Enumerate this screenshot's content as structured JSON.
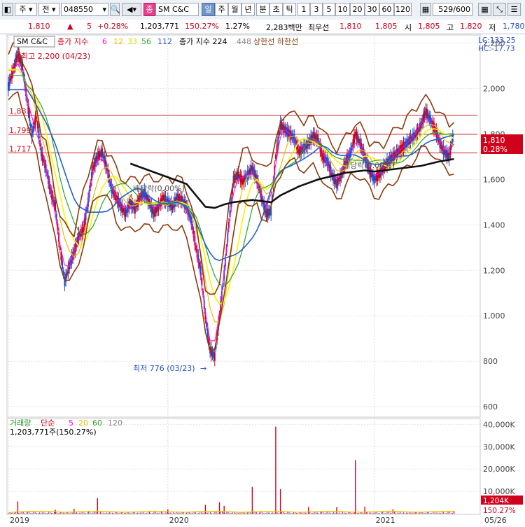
{
  "toolbar": {
    "kind": "주",
    "jeon": "전",
    "code": "048550",
    "jong": "종",
    "name": "SM C&C",
    "periods": [
      "일",
      "주",
      "월",
      "년",
      "분",
      "초",
      "틱"
    ],
    "active_period": "일",
    "intervals": [
      "1",
      "3",
      "5",
      "10",
      "20",
      "30",
      "60",
      "120"
    ],
    "count": "529",
    "total": "/600"
  },
  "info": {
    "price": "1,810",
    "change": "5",
    "change_pct": "+0.28%",
    "volume": "1,203,771",
    "vol_ratio": "150.27%",
    "turnover_rate": "1.27%",
    "amount": "2,283백만",
    "best_label": "최우선",
    "best_ask": "1,810",
    "best_bid": "1,805",
    "open_label": "시",
    "open": "1,805",
    "high_label": "고",
    "high": "1,820",
    "low_label": "저",
    "low": "1,780"
  },
  "legend": {
    "name": "SM C&C",
    "ma_label": "종가 지수",
    "ma_periods": [
      "6",
      "12",
      "33",
      "56",
      "112"
    ],
    "ma_colors": [
      "#ff00ff",
      "#e8c000",
      "#f0f000",
      "#2ca02c",
      "#1f5fd0"
    ],
    "ma2_label": "종가 지수 224",
    "ma2_period": "448",
    "limit_labels": "상한선 하한선",
    "lc": "LC:133.25",
    "hc": "HC:-17.73",
    "max_note": "최고 2,200 (04/23)",
    "min_note": "최저 776 (03/23)",
    "dividend_note1": "배당락(0.00%)",
    "dividend_note2": "배당락(0.00%)",
    "current_price_tag": "1,810",
    "current_pct_tag": "0.28%"
  },
  "volume_legend": {
    "label": "거래량",
    "ma_label": "단순",
    "periods": [
      "5",
      "20",
      "60",
      "120"
    ],
    "value": "1,203,771주(150.27%)",
    "current_tag": "1,204K",
    "current_pct": "150.27%"
  },
  "chart_data": {
    "type": "line",
    "price_axis": {
      "ylim": [
        560,
        2230
      ],
      "ticks": [
        "2,200",
        "2,000",
        "1,800",
        "1,600",
        "1,400",
        "1,200",
        "1,000",
        "800",
        "600"
      ],
      "tick_values": [
        2200,
        2000,
        1800,
        1600,
        1400,
        1200,
        1000,
        800,
        600
      ]
    },
    "h_lines": [
      {
        "label": "1,883",
        "value": 1883
      },
      {
        "label": "1,799",
        "value": 1799
      },
      {
        "label": "1,717",
        "value": 1717
      }
    ],
    "x_ticks": [
      "2019",
      "2020",
      "2021",
      "05/26"
    ],
    "x_tick_pos": [
      0,
      0.34,
      0.78,
      1.0
    ],
    "close_series": [
      [
        0,
        2010
      ],
      [
        0.01,
        2080
      ],
      [
        0.02,
        2150
      ],
      [
        0.03,
        2100
      ],
      [
        0.04,
        1950
      ],
      [
        0.05,
        1800
      ],
      [
        0.06,
        1880
      ],
      [
        0.07,
        1720
      ],
      [
        0.08,
        1650
      ],
      [
        0.09,
        1550
      ],
      [
        0.1,
        1480
      ],
      [
        0.11,
        1300
      ],
      [
        0.12,
        1150
      ],
      [
        0.13,
        1220
      ],
      [
        0.14,
        1280
      ],
      [
        0.15,
        1350
      ],
      [
        0.16,
        1380
      ],
      [
        0.17,
        1500
      ],
      [
        0.18,
        1650
      ],
      [
        0.19,
        1700
      ],
      [
        0.2,
        1720
      ],
      [
        0.21,
        1650
      ],
      [
        0.22,
        1560
      ],
      [
        0.23,
        1520
      ],
      [
        0.24,
        1480
      ],
      [
        0.25,
        1450
      ],
      [
        0.26,
        1500
      ],
      [
        0.27,
        1470
      ],
      [
        0.28,
        1520
      ],
      [
        0.29,
        1540
      ],
      [
        0.3,
        1500
      ],
      [
        0.31,
        1450
      ],
      [
        0.32,
        1480
      ],
      [
        0.33,
        1520
      ],
      [
        0.34,
        1500
      ],
      [
        0.35,
        1480
      ],
      [
        0.36,
        1520
      ],
      [
        0.37,
        1510
      ],
      [
        0.38,
        1480
      ],
      [
        0.39,
        1420
      ],
      [
        0.4,
        1300
      ],
      [
        0.41,
        1200
      ],
      [
        0.42,
        1000
      ],
      [
        0.43,
        850
      ],
      [
        0.44,
        820
      ],
      [
        0.45,
        1000
      ],
      [
        0.46,
        1180
      ],
      [
        0.47,
        1400
      ],
      [
        0.48,
        1600
      ],
      [
        0.49,
        1620
      ],
      [
        0.5,
        1590
      ],
      [
        0.51,
        1620
      ],
      [
        0.52,
        1650
      ],
      [
        0.53,
        1600
      ],
      [
        0.54,
        1520
      ],
      [
        0.55,
        1450
      ],
      [
        0.56,
        1460
      ],
      [
        0.57,
        1700
      ],
      [
        0.58,
        1840
      ],
      [
        0.59,
        1820
      ],
      [
        0.6,
        1800
      ],
      [
        0.61,
        1780
      ],
      [
        0.62,
        1720
      ],
      [
        0.63,
        1740
      ],
      [
        0.64,
        1760
      ],
      [
        0.65,
        1790
      ],
      [
        0.66,
        1780
      ],
      [
        0.67,
        1700
      ],
      [
        0.68,
        1680
      ],
      [
        0.69,
        1620
      ],
      [
        0.7,
        1580
      ],
      [
        0.71,
        1620
      ],
      [
        0.72,
        1680
      ],
      [
        0.73,
        1720
      ],
      [
        0.74,
        1800
      ],
      [
        0.75,
        1760
      ],
      [
        0.76,
        1700
      ],
      [
        0.77,
        1640
      ],
      [
        0.78,
        1600
      ],
      [
        0.79,
        1620
      ],
      [
        0.8,
        1650
      ],
      [
        0.81,
        1680
      ],
      [
        0.82,
        1700
      ],
      [
        0.83,
        1720
      ],
      [
        0.84,
        1740
      ],
      [
        0.85,
        1760
      ],
      [
        0.86,
        1780
      ],
      [
        0.87,
        1800
      ],
      [
        0.88,
        1840
      ],
      [
        0.89,
        1900
      ],
      [
        0.9,
        1860
      ],
      [
        0.91,
        1820
      ],
      [
        0.92,
        1760
      ],
      [
        0.93,
        1720
      ],
      [
        0.94,
        1700
      ],
      [
        0.95,
        1810
      ]
    ],
    "ma224": [
      [
        0.26,
        1670
      ],
      [
        0.3,
        1640
      ],
      [
        0.34,
        1610
      ],
      [
        0.38,
        1580
      ],
      [
        0.4,
        1530
      ],
      [
        0.42,
        1480
      ],
      [
        0.44,
        1475
      ],
      [
        0.46,
        1490
      ],
      [
        0.48,
        1500
      ],
      [
        0.52,
        1510
      ],
      [
        0.56,
        1500
      ],
      [
        0.58,
        1530
      ],
      [
        0.62,
        1570
      ],
      [
        0.66,
        1600
      ],
      [
        0.7,
        1620
      ],
      [
        0.72,
        1630
      ],
      [
        0.76,
        1640
      ],
      [
        0.78,
        1635
      ],
      [
        0.8,
        1640
      ],
      [
        0.84,
        1650
      ],
      [
        0.88,
        1660
      ],
      [
        0.92,
        1680
      ],
      [
        0.95,
        1690
      ]
    ],
    "volume_axis": {
      "ylim": [
        0,
        42000
      ],
      "ticks": [
        "40,000K",
        "30,000K",
        "20,000K",
        "10,000K"
      ],
      "tick_values": [
        40000,
        30000,
        20000,
        10000
      ]
    },
    "volume_spikes": [
      [
        0.02,
        5500
      ],
      [
        0.1,
        1800
      ],
      [
        0.14,
        2200
      ],
      [
        0.19,
        7000
      ],
      [
        0.34,
        2000
      ],
      [
        0.42,
        4000
      ],
      [
        0.45,
        5200
      ],
      [
        0.46,
        3500
      ],
      [
        0.52,
        12000
      ],
      [
        0.57,
        39000
      ],
      [
        0.58,
        11000
      ],
      [
        0.64,
        3000
      ],
      [
        0.7,
        3000
      ],
      [
        0.74,
        24000
      ],
      [
        0.76,
        3200
      ],
      [
        0.82,
        2000
      ],
      [
        0.95,
        1204
      ]
    ]
  }
}
